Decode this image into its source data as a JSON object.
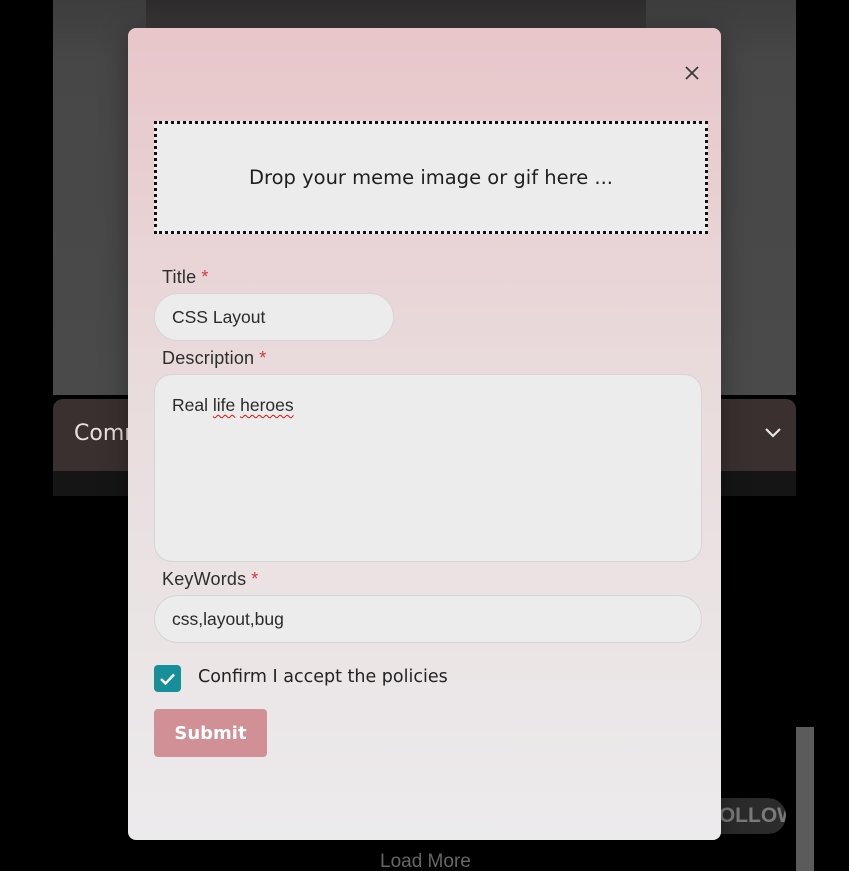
{
  "background": {
    "comments_label": "Comm",
    "follow_label": "FOLLOW",
    "load_more_label": "Load More"
  },
  "modal": {
    "dropzone_text": "Drop your meme image or gif here ...",
    "title_label": "Title",
    "title_value": "CSS Layout",
    "description_label": "Description",
    "description_prefix": "Real ",
    "description_word1": "life",
    "description_space": " ",
    "description_word2": "heroes",
    "keywords_label": "KeyWords",
    "keywords_value": "css,layout,bug",
    "required_marker": "*",
    "policy_label": "Confirm I accept the policies",
    "policy_checked": true,
    "submit_label": "Submit"
  },
  "icons": {
    "close": "close-icon",
    "check": "check-icon",
    "chevron": "chevron-down-icon"
  },
  "colors": {
    "checkbox": "#168f98",
    "submit": "#d09095",
    "required": "#d23b3b",
    "modal_top": "#e8c6ca"
  }
}
